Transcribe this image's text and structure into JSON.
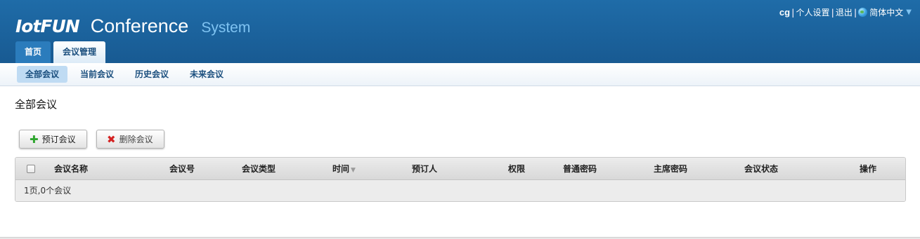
{
  "header": {
    "brand": "IotFUN",
    "conference": "Conference",
    "system": "System",
    "user": "cg",
    "sep": "|",
    "settings_label": "个人设置",
    "logout_label": "退出",
    "language_label": "简体中文",
    "language_caret": "▼"
  },
  "main_tabs": [
    {
      "label": "首页"
    },
    {
      "label": "会议管理"
    }
  ],
  "sub_tabs": [
    {
      "label": "全部会议"
    },
    {
      "label": "当前会议"
    },
    {
      "label": "历史会议"
    },
    {
      "label": "未来会议"
    }
  ],
  "page": {
    "title": "全部会议"
  },
  "toolbar": {
    "book_label": "预订会议",
    "book_icon": "plus-icon",
    "delete_label": "删除会议",
    "delete_icon": "cross-icon"
  },
  "table": {
    "columns": [
      "会议名称",
      "会议号",
      "会议类型",
      "时间",
      "预订人",
      "权限",
      "普通密码",
      "主席密码",
      "会议状态",
      "操作"
    ],
    "sort_indicator": "▼",
    "footer": "1页,0个会议"
  },
  "colors": {
    "header_bg": "#1f6ca8",
    "accent_light": "#7fc3f2",
    "active_subtab": "#bfdbf3"
  }
}
